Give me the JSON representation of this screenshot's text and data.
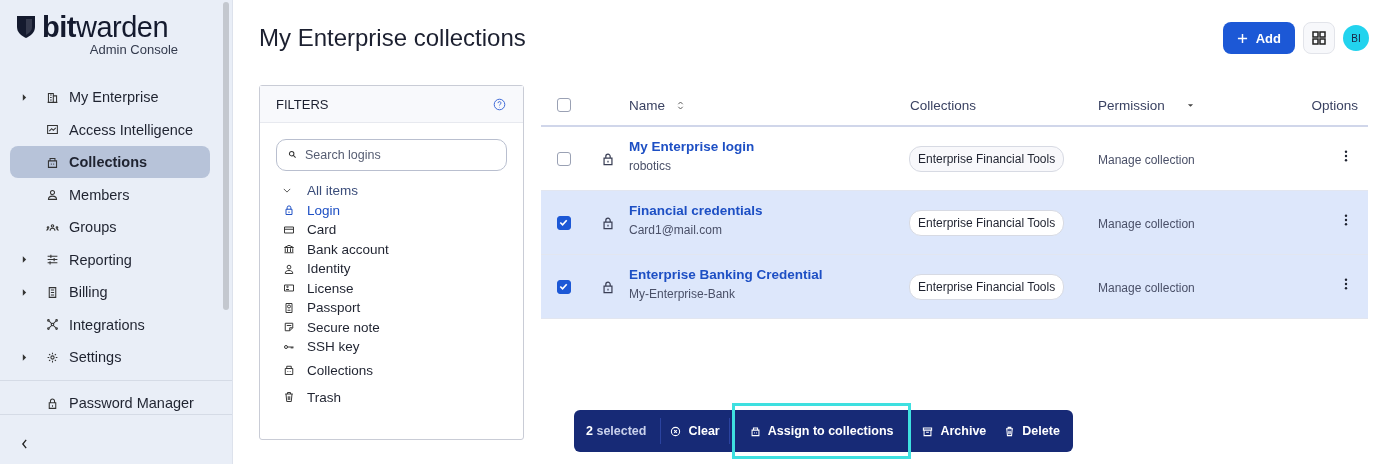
{
  "sidebar": {
    "logo": {
      "bold": "bit",
      "light": "warden",
      "subtitle": "Admin Console"
    },
    "items": [
      {
        "label": "My Enterprise",
        "kind": "building",
        "expandable": true,
        "selected": false
      },
      {
        "label": "Access Intelligence",
        "kind": "chart",
        "expandable": false,
        "selected": false
      },
      {
        "label": "Collections",
        "kind": "briefcase",
        "expandable": false,
        "selected": true
      },
      {
        "label": "Members",
        "kind": "user",
        "expandable": false,
        "selected": false
      },
      {
        "label": "Groups",
        "kind": "users",
        "expandable": false,
        "selected": false
      },
      {
        "label": "Reporting",
        "kind": "sliders",
        "expandable": true,
        "selected": false
      },
      {
        "label": "Billing",
        "kind": "document",
        "expandable": true,
        "selected": false
      },
      {
        "label": "Integrations",
        "kind": "hub",
        "expandable": false,
        "selected": false
      },
      {
        "label": "Settings",
        "kind": "gear",
        "expandable": true,
        "selected": false
      }
    ],
    "footer_items": [
      {
        "label": "Password Manager",
        "kind": "lock"
      }
    ]
  },
  "header": {
    "title": "My Enterprise collections",
    "add_button": "Add",
    "avatar": "BI"
  },
  "filters": {
    "title": "FILTERS",
    "search": {
      "placeholder": "Search logins"
    },
    "tree": {
      "label": "All items",
      "expanded": true,
      "children": [
        {
          "label": "Login",
          "kind": "lock",
          "selected": true
        },
        {
          "label": "Card",
          "kind": "card",
          "selected": false
        },
        {
          "label": "Bank account",
          "kind": "bank",
          "selected": false
        },
        {
          "label": "Identity",
          "kind": "user",
          "selected": false
        },
        {
          "label": "License",
          "kind": "idcard",
          "selected": false
        },
        {
          "label": "Passport",
          "kind": "passport",
          "selected": false
        },
        {
          "label": "Secure note",
          "kind": "note",
          "selected": false
        },
        {
          "label": "SSH key",
          "kind": "key",
          "selected": false
        }
      ]
    },
    "extra_items": [
      {
        "label": "Collections",
        "kind": "briefcase",
        "selected": false
      },
      {
        "label": "Trash",
        "kind": "trash",
        "selected": false
      }
    ]
  },
  "table": {
    "columns": [
      {
        "label": "Name",
        "kind": "sort"
      },
      {
        "label": "Collections",
        "kind": "plain"
      },
      {
        "label": "Permission",
        "kind": "dropdown"
      },
      {
        "label": "Options",
        "kind": "plain"
      }
    ],
    "all_checked": false,
    "rows": [
      {
        "checked": false,
        "name": "My Enterprise login",
        "subtitle": "robotics",
        "collection": "Enterprise Financial Tools",
        "permission": "Manage collection"
      },
      {
        "checked": true,
        "name": "Financial credentials",
        "subtitle": "Card1@mail.com",
        "collection": "Enterprise Financial Tools",
        "permission": "Manage collection"
      },
      {
        "checked": true,
        "name": "Enterprise Banking Credential",
        "subtitle": "My-Enterprise-Bank",
        "collection": "Enterprise Financial Tools",
        "permission": "Manage collection"
      }
    ]
  },
  "bulk_bar": {
    "count": "2",
    "count_label": "selected",
    "actions": [
      {
        "label": "Clear",
        "kind": "clear",
        "highlighted": false
      },
      {
        "label": "Assign to collections",
        "kind": "briefcase",
        "highlighted": true
      },
      {
        "label": "Archive",
        "kind": "archive",
        "highlighted": false
      },
      {
        "label": "Delete",
        "kind": "trash",
        "highlighted": false
      }
    ]
  }
}
